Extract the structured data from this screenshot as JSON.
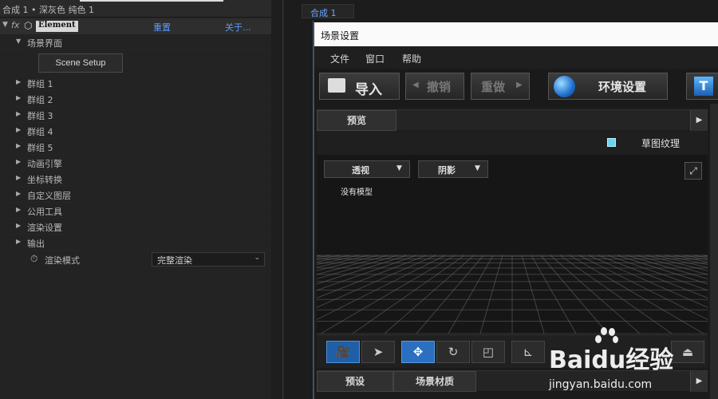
{
  "left_panel": {
    "top_text": "合成 1 • 深灰色 纯色 1",
    "fx_label": "fx",
    "effect_name": "Element",
    "reset_label": "重置",
    "about_label": "关于...",
    "scene_section_label": "场景界面",
    "scene_setup_button": "Scene Setup",
    "groups": [
      {
        "label": "群组 1"
      },
      {
        "label": "群组 2"
      },
      {
        "label": "群组 3"
      },
      {
        "label": "群组 4"
      },
      {
        "label": "群组 5"
      },
      {
        "label": "动画引擎"
      },
      {
        "label": "坐标转换"
      },
      {
        "label": "自定义图层"
      },
      {
        "label": "公用工具"
      },
      {
        "label": "渲染设置"
      },
      {
        "label": "输出"
      }
    ],
    "render_mode_label": "渲染模式",
    "render_mode_value": "完整渲染"
  },
  "comp_panel": {
    "tab_label": "合成 1"
  },
  "scene_window": {
    "title": "场景设置",
    "menu": [
      "文件",
      "窗口",
      "帮助"
    ],
    "toolbar": {
      "import_label": "导入",
      "undo_label": "撤销",
      "redo_label": "重做",
      "env_label": "环境设置"
    },
    "preview_tab": "预览",
    "draft_texture_label": "草图纹理",
    "view_dropdown": "透视",
    "shadow_dropdown": "阴影",
    "no_model_text": "没有模型",
    "bottom_tabs": [
      "预设",
      "场景材质"
    ]
  },
  "watermark": {
    "brand": "Baidu经验",
    "url": "jingyan.baidu.com"
  },
  "colors": {
    "accent_blue": "#4a90e2",
    "link_blue": "#5a9bff",
    "checkbox_cyan": "#6cd3f0"
  }
}
